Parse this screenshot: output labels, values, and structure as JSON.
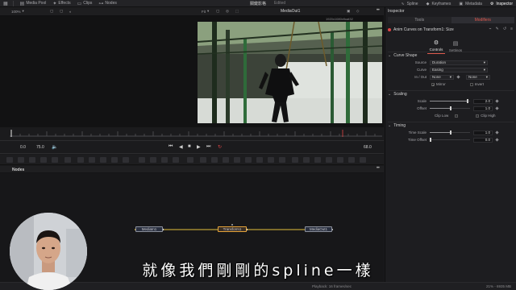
{
  "topbar": {
    "items": [
      {
        "label": "Media Pool",
        "icon": "media-pool-icon"
      },
      {
        "label": "Effects",
        "icon": "effects-icon"
      },
      {
        "label": "Clips",
        "icon": "clips-icon"
      },
      {
        "label": "Nodes",
        "icon": "nodes-icon"
      }
    ],
    "project_title": "關鍵影格",
    "project_status": "Edited",
    "right_items": [
      {
        "label": "Spline",
        "icon": "spline-icon"
      },
      {
        "label": "Keyframes",
        "icon": "keyframes-icon"
      },
      {
        "label": "Metadata",
        "icon": "metadata-icon"
      },
      {
        "label": "Inspector",
        "icon": "inspector-icon"
      }
    ]
  },
  "viewer_bar": {
    "zoom": "100%",
    "fit": "Fit",
    "clip_name": "MediaOut1",
    "resolution": "1920x1080xfloat32"
  },
  "transport": {
    "start": "0.0",
    "current": "75.0",
    "end": "68.0"
  },
  "nodes": {
    "title": "Nodes",
    "node_list": [
      {
        "label": "MediaIn1"
      },
      {
        "label": "Transform1"
      },
      {
        "label": "MediaOut1"
      }
    ]
  },
  "statusbar": {
    "left": "[Mon",
    "playback": "Playback: 16 frames/sec",
    "memory": "21% - 6935 MB"
  },
  "inspector": {
    "title": "Inspector",
    "tabs": [
      "Tools",
      "Modifiers"
    ],
    "active_tab": "Modifiers",
    "node_name": "Anim Curves on Transform1: Size",
    "sub_tabs": [
      "Controls",
      "Settings"
    ],
    "sections": {
      "curve_shape": {
        "title": "Curve Shape",
        "source_label": "Source",
        "source_value": "Duration",
        "curve_label": "Curve",
        "curve_value": "Easing",
        "inout_label": "In / Out",
        "in_value": "None",
        "out_value": "None",
        "mirror_label": "Mirror",
        "invert_label": "Invert"
      },
      "scaling": {
        "title": "Scaling",
        "scale_label": "Scale",
        "scale_value": "2.0",
        "offset_label": "Offset",
        "offset_value": "1.0",
        "clip_low_label": "Clip Low",
        "clip_high_label": "Clip High"
      },
      "timing": {
        "title": "Timing",
        "time_scale_label": "Time Scale",
        "time_scale_value": "1.0",
        "time_offset_label": "Time Offset",
        "time_offset_value": "0.0"
      }
    }
  },
  "subtitle": "就像我們剛剛的spline一樣",
  "colors": {
    "accent": "#e05c4f",
    "selected_node": "#e5a33a",
    "connection": "#e5c13a"
  }
}
